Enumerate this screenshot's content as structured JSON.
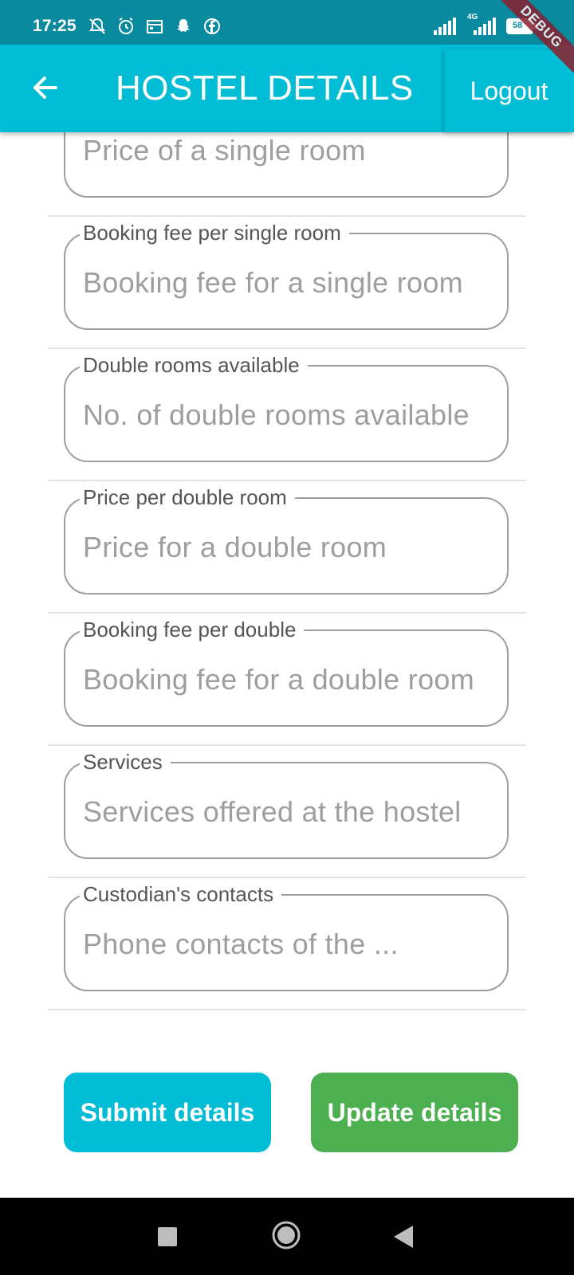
{
  "status_bar": {
    "time": "17:25",
    "network": "4G",
    "battery": "58"
  },
  "debug_banner": "DEBUG",
  "app_bar": {
    "title": "HOSTEL DETAILS",
    "logout_label": "Logout"
  },
  "form": {
    "fields": [
      {
        "label": "",
        "placeholder": "Price of a single room"
      },
      {
        "label": "Booking fee per single room",
        "placeholder": "Booking fee for a single room"
      },
      {
        "label": "Double rooms available",
        "placeholder": "No. of double rooms available"
      },
      {
        "label": "Price per double room",
        "placeholder": "Price for a double room"
      },
      {
        "label": "Booking fee per double",
        "placeholder": "Booking fee for a double room"
      },
      {
        "label": "Services",
        "placeholder": "Services offered at the hostel"
      },
      {
        "label": "Custodian's contacts",
        "placeholder": "Phone contacts of the ..."
      }
    ]
  },
  "actions": {
    "submit_label": "Submit details",
    "update_label": "Update details"
  },
  "colors": {
    "status_bar": "#0a8a9f",
    "app_bar": "#00bcd4",
    "submit_button": "#00bcd4",
    "update_button": "#4caf50"
  }
}
